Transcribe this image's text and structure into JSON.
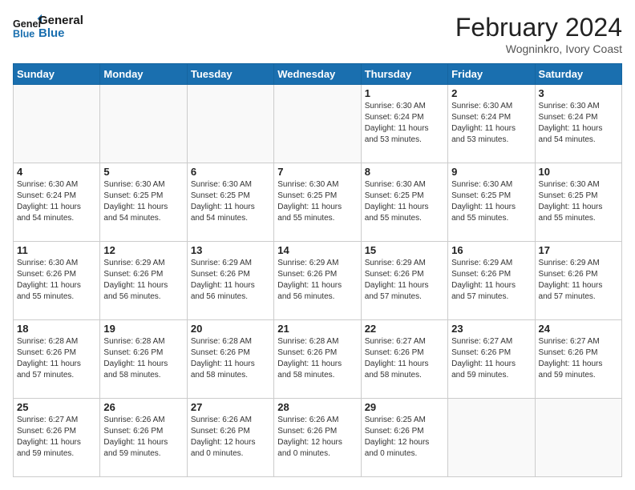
{
  "header": {
    "logo_general": "General",
    "logo_blue": "Blue",
    "month_title": "February 2024",
    "location": "Wogninkro, Ivory Coast"
  },
  "days_of_week": [
    "Sunday",
    "Monday",
    "Tuesday",
    "Wednesday",
    "Thursday",
    "Friday",
    "Saturday"
  ],
  "weeks": [
    [
      {
        "day": "",
        "info": ""
      },
      {
        "day": "",
        "info": ""
      },
      {
        "day": "",
        "info": ""
      },
      {
        "day": "",
        "info": ""
      },
      {
        "day": "1",
        "info": "Sunrise: 6:30 AM\nSunset: 6:24 PM\nDaylight: 11 hours\nand 53 minutes."
      },
      {
        "day": "2",
        "info": "Sunrise: 6:30 AM\nSunset: 6:24 PM\nDaylight: 11 hours\nand 53 minutes."
      },
      {
        "day": "3",
        "info": "Sunrise: 6:30 AM\nSunset: 6:24 PM\nDaylight: 11 hours\nand 54 minutes."
      }
    ],
    [
      {
        "day": "4",
        "info": "Sunrise: 6:30 AM\nSunset: 6:24 PM\nDaylight: 11 hours\nand 54 minutes."
      },
      {
        "day": "5",
        "info": "Sunrise: 6:30 AM\nSunset: 6:25 PM\nDaylight: 11 hours\nand 54 minutes."
      },
      {
        "day": "6",
        "info": "Sunrise: 6:30 AM\nSunset: 6:25 PM\nDaylight: 11 hours\nand 54 minutes."
      },
      {
        "day": "7",
        "info": "Sunrise: 6:30 AM\nSunset: 6:25 PM\nDaylight: 11 hours\nand 55 minutes."
      },
      {
        "day": "8",
        "info": "Sunrise: 6:30 AM\nSunset: 6:25 PM\nDaylight: 11 hours\nand 55 minutes."
      },
      {
        "day": "9",
        "info": "Sunrise: 6:30 AM\nSunset: 6:25 PM\nDaylight: 11 hours\nand 55 minutes."
      },
      {
        "day": "10",
        "info": "Sunrise: 6:30 AM\nSunset: 6:25 PM\nDaylight: 11 hours\nand 55 minutes."
      }
    ],
    [
      {
        "day": "11",
        "info": "Sunrise: 6:30 AM\nSunset: 6:26 PM\nDaylight: 11 hours\nand 55 minutes."
      },
      {
        "day": "12",
        "info": "Sunrise: 6:29 AM\nSunset: 6:26 PM\nDaylight: 11 hours\nand 56 minutes."
      },
      {
        "day": "13",
        "info": "Sunrise: 6:29 AM\nSunset: 6:26 PM\nDaylight: 11 hours\nand 56 minutes."
      },
      {
        "day": "14",
        "info": "Sunrise: 6:29 AM\nSunset: 6:26 PM\nDaylight: 11 hours\nand 56 minutes."
      },
      {
        "day": "15",
        "info": "Sunrise: 6:29 AM\nSunset: 6:26 PM\nDaylight: 11 hours\nand 57 minutes."
      },
      {
        "day": "16",
        "info": "Sunrise: 6:29 AM\nSunset: 6:26 PM\nDaylight: 11 hours\nand 57 minutes."
      },
      {
        "day": "17",
        "info": "Sunrise: 6:29 AM\nSunset: 6:26 PM\nDaylight: 11 hours\nand 57 minutes."
      }
    ],
    [
      {
        "day": "18",
        "info": "Sunrise: 6:28 AM\nSunset: 6:26 PM\nDaylight: 11 hours\nand 57 minutes."
      },
      {
        "day": "19",
        "info": "Sunrise: 6:28 AM\nSunset: 6:26 PM\nDaylight: 11 hours\nand 58 minutes."
      },
      {
        "day": "20",
        "info": "Sunrise: 6:28 AM\nSunset: 6:26 PM\nDaylight: 11 hours\nand 58 minutes."
      },
      {
        "day": "21",
        "info": "Sunrise: 6:28 AM\nSunset: 6:26 PM\nDaylight: 11 hours\nand 58 minutes."
      },
      {
        "day": "22",
        "info": "Sunrise: 6:27 AM\nSunset: 6:26 PM\nDaylight: 11 hours\nand 58 minutes."
      },
      {
        "day": "23",
        "info": "Sunrise: 6:27 AM\nSunset: 6:26 PM\nDaylight: 11 hours\nand 59 minutes."
      },
      {
        "day": "24",
        "info": "Sunrise: 6:27 AM\nSunset: 6:26 PM\nDaylight: 11 hours\nand 59 minutes."
      }
    ],
    [
      {
        "day": "25",
        "info": "Sunrise: 6:27 AM\nSunset: 6:26 PM\nDaylight: 11 hours\nand 59 minutes."
      },
      {
        "day": "26",
        "info": "Sunrise: 6:26 AM\nSunset: 6:26 PM\nDaylight: 11 hours\nand 59 minutes."
      },
      {
        "day": "27",
        "info": "Sunrise: 6:26 AM\nSunset: 6:26 PM\nDaylight: 12 hours\nand 0 minutes."
      },
      {
        "day": "28",
        "info": "Sunrise: 6:26 AM\nSunset: 6:26 PM\nDaylight: 12 hours\nand 0 minutes."
      },
      {
        "day": "29",
        "info": "Sunrise: 6:25 AM\nSunset: 6:26 PM\nDaylight: 12 hours\nand 0 minutes."
      },
      {
        "day": "",
        "info": ""
      },
      {
        "day": "",
        "info": ""
      }
    ]
  ]
}
